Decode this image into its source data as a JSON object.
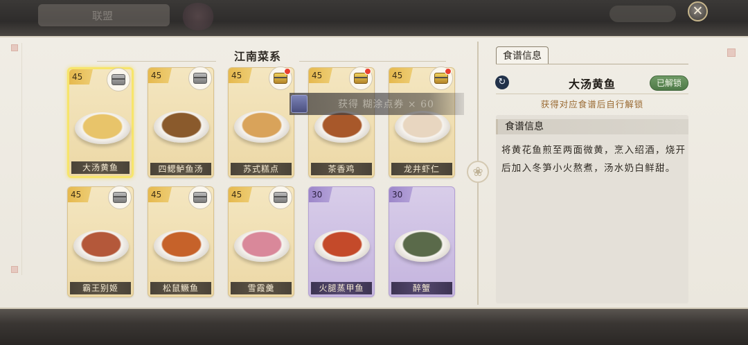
{
  "header": {
    "blurred_tab_label": "联盟"
  },
  "close_button": {
    "glyph": "✕"
  },
  "section": {
    "title": "江南菜系"
  },
  "toast": {
    "text": "获得 糊涂点券 × 60"
  },
  "cards": [
    {
      "name": "大汤黄鱼",
      "level": "45",
      "chest": "silver",
      "alert": false,
      "rarity": "gold",
      "selected": true,
      "food_color": "#e8c46a"
    },
    {
      "name": "四鳃鲈鱼汤",
      "level": "45",
      "chest": "silver",
      "alert": false,
      "rarity": "gold",
      "selected": false,
      "food_color": "#8a5a2c"
    },
    {
      "name": "苏式糕点",
      "level": "45",
      "chest": "gold",
      "alert": true,
      "rarity": "gold",
      "selected": false,
      "food_color": "#d9a35a"
    },
    {
      "name": "茶香鸡",
      "level": "45",
      "chest": "gold",
      "alert": true,
      "rarity": "gold",
      "selected": false,
      "food_color": "#a8582a"
    },
    {
      "name": "龙井虾仁",
      "level": "45",
      "chest": "gold",
      "alert": true,
      "rarity": "gold",
      "selected": false,
      "food_color": "#e8d6c0"
    },
    {
      "name": "霸王别姬",
      "level": "45",
      "chest": "silver",
      "alert": false,
      "rarity": "gold",
      "selected": false,
      "food_color": "#b4583a"
    },
    {
      "name": "松鼠鳜鱼",
      "level": "45",
      "chest": "silver",
      "alert": false,
      "rarity": "gold",
      "selected": false,
      "food_color": "#c6622a"
    },
    {
      "name": "雪霞羹",
      "level": "45",
      "chest": "silver",
      "alert": false,
      "rarity": "gold",
      "selected": false,
      "food_color": "#d9889a"
    },
    {
      "name": "火腿蒸甲鱼",
      "level": "30",
      "chest": "none",
      "alert": false,
      "rarity": "purple",
      "selected": false,
      "food_color": "#c44a2a"
    },
    {
      "name": "醉蟹",
      "level": "30",
      "chest": "none",
      "alert": false,
      "rarity": "purple",
      "selected": false,
      "food_color": "#5a6a4a"
    }
  ],
  "detail": {
    "tab_label": "食谱信息",
    "dish_name": "大汤黄鱼",
    "unlock_badge": "已解锁",
    "unlock_hint": "获得对应食谱后自行解锁",
    "recipe_heading": "食谱信息",
    "recipe_text": "将黄花鱼煎至两面微黄，烹入绍酒，烧开后加入冬笋小火熬煮，汤水奶白鲜甜。"
  },
  "icons": {
    "refresh": "refresh-icon",
    "ornament": "flower-ornament-icon"
  }
}
